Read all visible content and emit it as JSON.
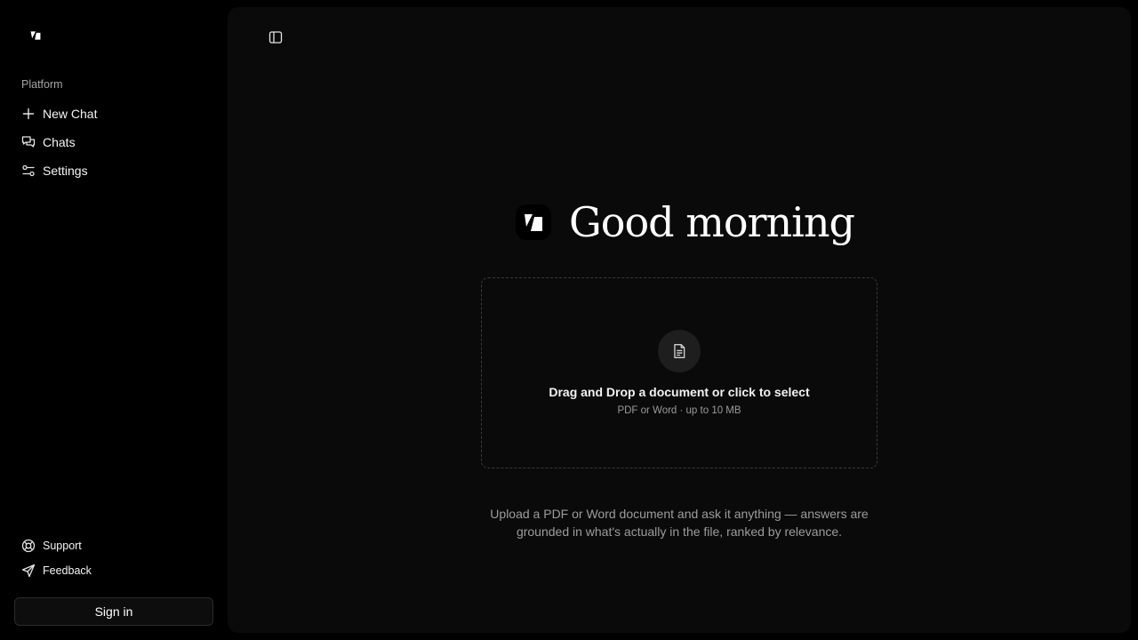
{
  "sidebar": {
    "section_label": "Platform",
    "items": [
      {
        "label": "New Chat",
        "icon": "plus-icon"
      },
      {
        "label": "Chats",
        "icon": "chats-icon"
      },
      {
        "label": "Settings",
        "icon": "sliders-icon"
      }
    ],
    "footer": [
      {
        "label": "Support",
        "icon": "lifebuoy-icon"
      },
      {
        "label": "Feedback",
        "icon": "send-icon"
      }
    ],
    "sign_in_label": "Sign in"
  },
  "main": {
    "greeting": "Good morning",
    "dropzone": {
      "title": "Drag and Drop a document or click to select",
      "subtitle": "PDF or Word · up to 10 MB",
      "icon": "document-icon"
    },
    "description": "Upload a PDF or Word document and ask it anything — answers are grounded in what's actually in the file, ranked by relevance."
  },
  "colors": {
    "sidebar_bg": "#000000",
    "main_bg": "#0a0a0a",
    "text": "#ffffff",
    "muted": "#9c9c9c"
  }
}
